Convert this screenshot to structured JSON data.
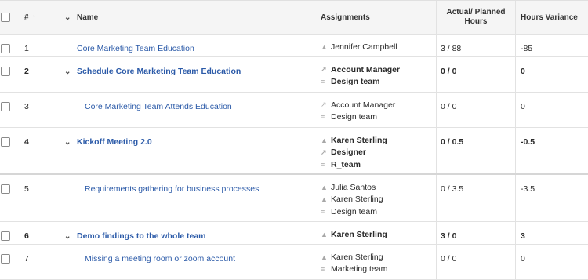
{
  "header": {
    "num_label": "#",
    "sort_icon": "↑",
    "name_label": "Name",
    "assignments_label": "Assignments",
    "actual_planned_label": "Actual/ Planned Hours",
    "variance_label": "Hours Variance"
  },
  "rows": [
    {
      "num": "1",
      "name": "Core Marketing Team Education",
      "assignments": [
        {
          "icon": "person-icon",
          "text": "Jennifer Campbell"
        }
      ],
      "actual_planned": "3 / 88",
      "variance": "-85"
    },
    {
      "num": "2",
      "name": "Schedule Core Marketing Team Education",
      "assignments": [
        {
          "icon": "role-icon",
          "text": "Account Manager"
        },
        {
          "icon": "team-icon",
          "text": "Design team"
        }
      ],
      "actual_planned": "0 / 0",
      "variance": "0"
    },
    {
      "num": "3",
      "name": "Core Marketing Team Attends Education",
      "assignments": [
        {
          "icon": "role-icon",
          "text": "Account Manager"
        },
        {
          "icon": "team-icon",
          "text": "Design team"
        }
      ],
      "actual_planned": "0 / 0",
      "variance": "0"
    },
    {
      "num": "4",
      "name": "Kickoff Meeting 2.0",
      "assignments": [
        {
          "icon": "person-icon",
          "text": "Karen Sterling"
        },
        {
          "icon": "role-icon",
          "text": "Designer"
        },
        {
          "icon": "team-icon",
          "text": "R_team"
        }
      ],
      "actual_planned": "0 / 0.5",
      "variance": "-0.5"
    },
    {
      "num": "5",
      "name": "Requirements gathering for business processes",
      "assignments": [
        {
          "icon": "person-icon",
          "text": "Julia Santos"
        },
        {
          "icon": "person-icon",
          "text": "Karen Sterling"
        },
        {
          "icon": "team-icon",
          "text": "Design team"
        }
      ],
      "actual_planned": "0 / 3.5",
      "variance": "-3.5"
    },
    {
      "num": "6",
      "name": "Demo findings to the whole team",
      "assignments": [
        {
          "icon": "person-icon",
          "text": "Karen Sterling"
        }
      ],
      "actual_planned": "3 / 0",
      "variance": "3"
    },
    {
      "num": "7",
      "name": "Missing a meeting room or zoom account",
      "assignments": [
        {
          "icon": "person-icon",
          "text": "Karen Sterling"
        },
        {
          "icon": "team-icon",
          "text": "Marketing team"
        }
      ],
      "actual_planned": "0 / 0",
      "variance": "0"
    }
  ],
  "colors": {
    "link": "#2b5aa8",
    "header_bg": "#f5f5f5",
    "grid_line": "#e2e2e2"
  }
}
